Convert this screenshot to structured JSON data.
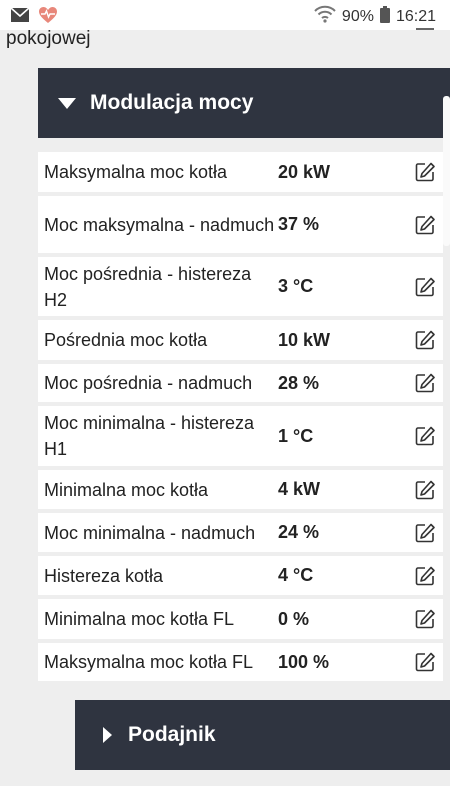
{
  "status_bar": {
    "battery": "90%",
    "time": "16:21",
    "icons": [
      "mail-icon",
      "heart-pulse-icon",
      "wifi-icon",
      "battery-icon"
    ],
    "accent_color": "#e8877a"
  },
  "previous_item": {
    "label": "pokojowej"
  },
  "section_modulacja": {
    "title": "Modulacja mocy"
  },
  "rows": [
    {
      "label": "Maksymalna moc kotła",
      "value": "20 kW"
    },
    {
      "label": "Moc maksymalna - nadmuch",
      "value": "37 %"
    },
    {
      "label": "Moc pośrednia - histereza H2",
      "value": "3 °C"
    },
    {
      "label": "Pośrednia moc kotła",
      "value": "10 kW"
    },
    {
      "label": "Moc pośrednia - nadmuch",
      "value": "28 %"
    },
    {
      "label": "Moc minimalna - histereza H1",
      "value": "1 °C"
    },
    {
      "label": "Minimalna moc kotła",
      "value": "4 kW"
    },
    {
      "label": "Moc minimalna - nadmuch",
      "value": "24 %"
    },
    {
      "label": "Histereza kotła",
      "value": "4 °C"
    },
    {
      "label": "Minimalna moc kotła FL",
      "value": "0 %"
    },
    {
      "label": "Maksymalna moc kotła FL",
      "value": "100 %"
    }
  ],
  "section_podajnik": {
    "title": "Podajnik"
  },
  "colors": {
    "header_bg": "#2f3440",
    "page_bg": "#eeeeee",
    "row_bg": "#ffffff"
  }
}
